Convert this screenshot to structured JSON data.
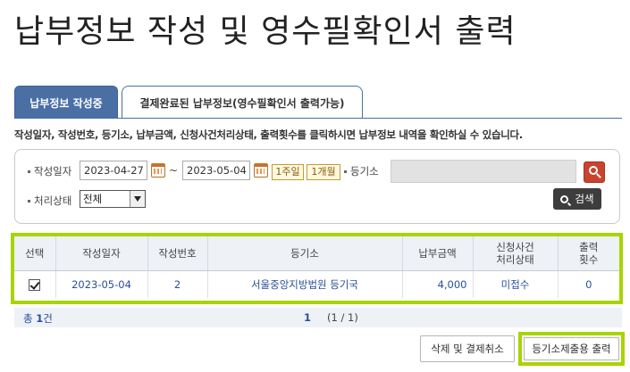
{
  "page_title": "납부정보 작성 및 영수필확인서 출력",
  "tabs": [
    {
      "label": "납부정보 작성중",
      "active": true
    },
    {
      "label": "결제완료된 납부정보(영수필확인서 출력가능)",
      "active": false
    }
  ],
  "guide_text": "작성일자, 작성번호, 등기소, 납부금액, 신청사건처리상태, 출력횟수를 클릭하시면 납부정보 내역을 확인하실 수 있습니다.",
  "search": {
    "date_label": "작성일자",
    "date_from": "2023-04-27",
    "date_sep": "~",
    "date_to": "2023-05-04",
    "one_week": "1주일",
    "one_month": "1개월",
    "registry_label": "등기소",
    "registry_value": "",
    "status_label": "처리상태",
    "status_value": "전체",
    "search_button": "검색"
  },
  "table": {
    "headers": [
      "선택",
      "작성일자",
      "작성번호",
      "등기소",
      "납부금액",
      "신청사건\n처리상태",
      "출력\n횟수"
    ],
    "rows": [
      {
        "checked": true,
        "date": "2023-05-04",
        "number": "2",
        "registry": "서울중앙지방법원 등기국",
        "amount": "4,000",
        "status": "미접수",
        "print_count": "0"
      }
    ]
  },
  "footer": {
    "total_prefix": "총",
    "total_count": "1",
    "total_suffix": "건",
    "current_page": "1",
    "page_info": "(1 / 1)"
  },
  "buttons": {
    "delete": "삭제 및 결제취소",
    "print": "등기소제출용 출력"
  },
  "colors": {
    "tab_active": "#4a6fa5",
    "highlight": "#a8d400",
    "link": "#2a4f9a",
    "search_button": "#c8442e"
  }
}
